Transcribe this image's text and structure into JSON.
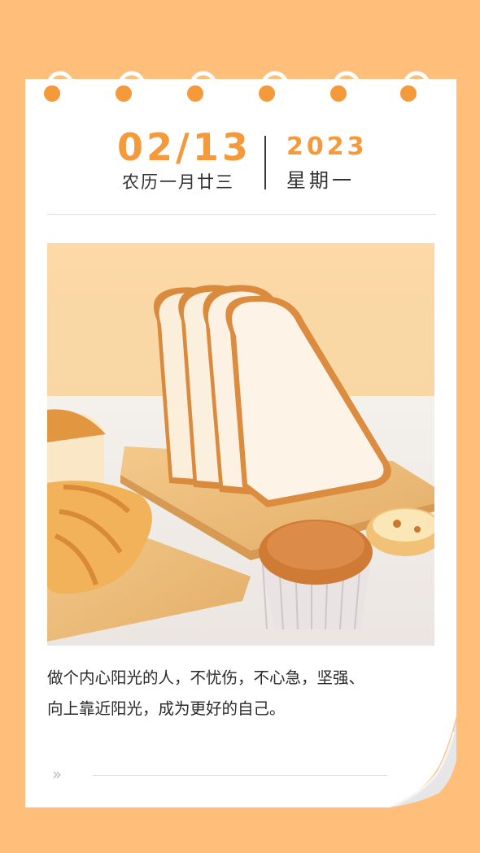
{
  "date": {
    "main": "02/13",
    "lunar": "农历一月廿三",
    "year": "2023",
    "weekday": "星期一"
  },
  "quote": {
    "line1": "做个内心阳光的人，不忧伤，不心急，坚强、",
    "line2": "向上靠近阳光，成为更好的自己。"
  },
  "footer": {
    "arrow_glyph": "››"
  },
  "colors": {
    "background": "#FFBE7A",
    "accent": "#F49A3B",
    "card": "#FFFFFF"
  },
  "photo": {
    "subject": "bread-slices-croissant-muffin-egg-tart"
  }
}
